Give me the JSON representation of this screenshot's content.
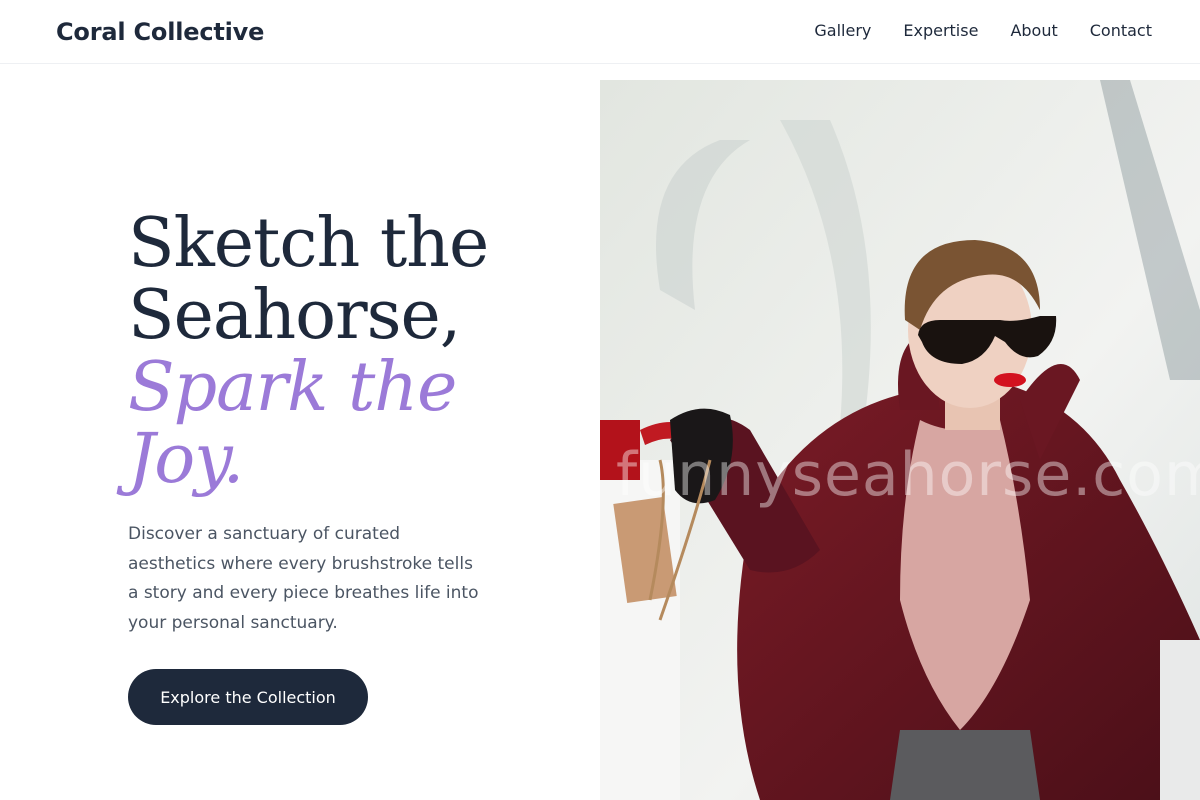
{
  "header": {
    "brand": "Coral Collective",
    "nav": [
      "Gallery",
      "Expertise",
      "About",
      "Contact"
    ]
  },
  "hero": {
    "headline_lines": [
      "Sketch the",
      "Seahorse,"
    ],
    "headline_accent_lines": [
      "Spark the",
      "Joy."
    ],
    "lead": "Discover a sanctuary of curated aesthetics where every brushstroke tells a story and every piece breathes life into your personal sanctuary.",
    "cta_label": "Explore the Collection"
  },
  "photo": {
    "watermark": "funnyseahorse.com",
    "subject": "woman in sunglasses and burgundy coat holding shopping bags"
  },
  "colors": {
    "text_dark": "#1e293b",
    "accent": "#9b7ad8",
    "body_text": "#4b5563",
    "cta_background": "#1e293b"
  }
}
